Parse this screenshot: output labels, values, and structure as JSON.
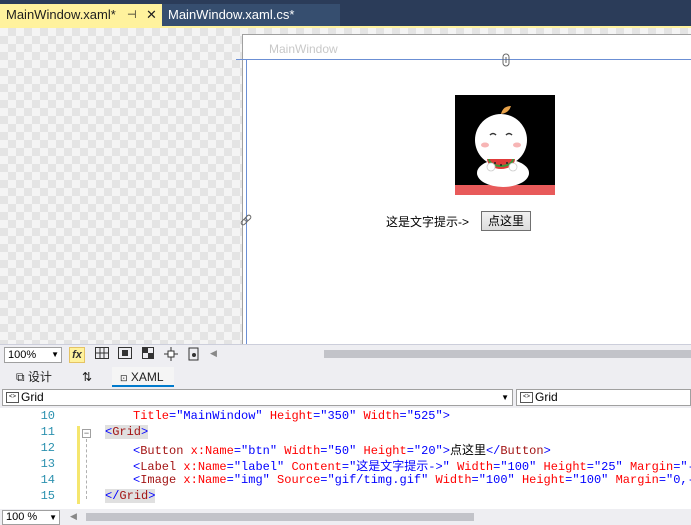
{
  "tabs": [
    {
      "label": "MainWindow.xaml*",
      "pin": "⊣",
      "close": "✕"
    },
    {
      "label": "MainWindow.xaml.cs*"
    }
  ],
  "designer": {
    "window_title": "MainWindow",
    "label_text": "这是文字提示->",
    "button_text": "点这里"
  },
  "toolbar": {
    "zoom": "100%",
    "fx": "fx"
  },
  "view_tabs": {
    "design": "设计",
    "swap": "⇅",
    "xaml": "XAML"
  },
  "nav": {
    "left": "Grid",
    "right": "Grid"
  },
  "code": {
    "line_numbers": [
      "10",
      "11",
      "12",
      "13",
      "14",
      "15"
    ],
    "lines": [
      [
        {
          "c": "at",
          "t": "Title"
        },
        {
          "c": "bl",
          "t": "="
        },
        {
          "c": "vl",
          "t": "\"MainWindow\""
        },
        {
          "c": "at",
          "t": " Height"
        },
        {
          "c": "bl",
          "t": "="
        },
        {
          "c": "vl",
          "t": "\"350\""
        },
        {
          "c": "at",
          "t": " Width"
        },
        {
          "c": "bl",
          "t": "="
        },
        {
          "c": "vl",
          "t": "\"525\""
        },
        {
          "c": "bl",
          "t": ">"
        }
      ],
      [
        {
          "c": "bl hl",
          "t": "<"
        },
        {
          "c": "el hl",
          "t": "Grid"
        },
        {
          "c": "bl hl",
          "t": ">"
        }
      ],
      [
        {
          "c": "bl",
          "t": "<"
        },
        {
          "c": "el",
          "t": "Button"
        },
        {
          "c": "at",
          "t": " x:Name"
        },
        {
          "c": "bl",
          "t": "="
        },
        {
          "c": "vl",
          "t": "\"btn\""
        },
        {
          "c": "at",
          "t": " Width"
        },
        {
          "c": "bl",
          "t": "="
        },
        {
          "c": "vl",
          "t": "\"50\""
        },
        {
          "c": "at",
          "t": " Height"
        },
        {
          "c": "bl",
          "t": "="
        },
        {
          "c": "vl",
          "t": "\"20\""
        },
        {
          "c": "bl",
          "t": ">"
        },
        {
          "c": "tx",
          "t": "点这里"
        },
        {
          "c": "bl",
          "t": "</"
        },
        {
          "c": "el",
          "t": "Button"
        },
        {
          "c": "bl",
          "t": ">"
        }
      ],
      [
        {
          "c": "bl",
          "t": "<"
        },
        {
          "c": "el",
          "t": "Label"
        },
        {
          "c": "at",
          "t": " x:Name"
        },
        {
          "c": "bl",
          "t": "="
        },
        {
          "c": "vl",
          "t": "\"label\""
        },
        {
          "c": "at",
          "t": " Content"
        },
        {
          "c": "bl",
          "t": "="
        },
        {
          "c": "vl",
          "t": "\"这是文字提示->\""
        },
        {
          "c": "at",
          "t": " Width"
        },
        {
          "c": "bl",
          "t": "="
        },
        {
          "c": "vl",
          "t": "\"100\""
        },
        {
          "c": "at",
          "t": " Height"
        },
        {
          "c": "bl",
          "t": "="
        },
        {
          "c": "vl",
          "t": "\"25\""
        },
        {
          "c": "at",
          "t": " Margin"
        },
        {
          "c": "bl",
          "t": "="
        },
        {
          "c": "vl",
          "t": "\"-"
        }
      ],
      [
        {
          "c": "bl",
          "t": "<"
        },
        {
          "c": "el",
          "t": "Image"
        },
        {
          "c": "at",
          "t": " x:Name"
        },
        {
          "c": "bl",
          "t": "="
        },
        {
          "c": "vl",
          "t": "\"img\""
        },
        {
          "c": "at",
          "t": " Source"
        },
        {
          "c": "bl",
          "t": "="
        },
        {
          "c": "vl",
          "t": "\"gif/timg.gif\""
        },
        {
          "c": "at",
          "t": " Width"
        },
        {
          "c": "bl",
          "t": "="
        },
        {
          "c": "vl",
          "t": "\"100\""
        },
        {
          "c": "at",
          "t": " Height"
        },
        {
          "c": "bl",
          "t": "="
        },
        {
          "c": "vl",
          "t": "\"100\""
        },
        {
          "c": "at",
          "t": " Margin"
        },
        {
          "c": "bl",
          "t": "="
        },
        {
          "c": "vl",
          "t": "\"0,-15"
        }
      ],
      [
        {
          "c": "bl hl",
          "t": "</"
        },
        {
          "c": "el hl",
          "t": "Grid"
        },
        {
          "c": "bl hl",
          "t": ">"
        }
      ]
    ]
  },
  "bottom": {
    "zoom": "100 %"
  }
}
